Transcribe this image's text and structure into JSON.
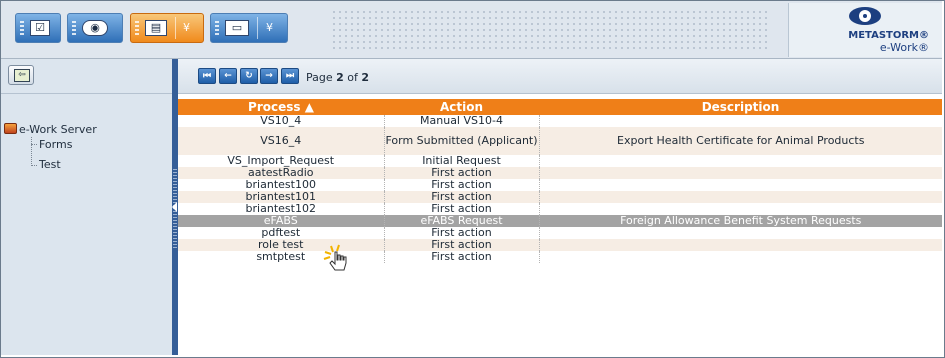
{
  "toolbar": {
    "buttons": [
      {
        "name": "todo-list",
        "icon": "checkbox-icon",
        "glyph": "☑"
      },
      {
        "name": "watch-list",
        "icon": "eye-icon",
        "glyph": "◉"
      },
      {
        "name": "procedures",
        "icon": "documents-icon",
        "glyph": "▤"
      },
      {
        "name": "folders",
        "icon": "briefcase-icon",
        "glyph": "▭"
      }
    ],
    "dropdown_glyph": "¥"
  },
  "logo": {
    "name": "METASTORM®",
    "sub": "e-Work®"
  },
  "left_pane": {
    "back_glyph": "⇦",
    "tree": {
      "root": "e-Work Server",
      "children": [
        "Forms",
        "Test"
      ]
    }
  },
  "pager": {
    "first": "⏮",
    "prev": "←",
    "refresh": "↻",
    "next": "→",
    "last": "⏭",
    "text_prefix": "Page ",
    "current": "2",
    "text_mid": " of ",
    "total": "2"
  },
  "table": {
    "headers": {
      "process": "Process ▲",
      "action": "Action",
      "description": "Description"
    },
    "rows": [
      {
        "process": "VS10_4",
        "action": "Manual VS10-4",
        "description": ""
      },
      {
        "process": "VS16_4",
        "action": "Form Submitted (Applicant)",
        "description": "Export Health Certificate for Animal Products"
      },
      {
        "process": "VS_Import_Request",
        "action": "Initial Request",
        "description": ""
      },
      {
        "process": "aatestRadio",
        "action": "First action",
        "description": ""
      },
      {
        "process": "briantest100",
        "action": "First action",
        "description": ""
      },
      {
        "process": "briantest101",
        "action": "First action",
        "description": ""
      },
      {
        "process": "briantest102",
        "action": "First action",
        "description": ""
      },
      {
        "process": "eFABS",
        "action": "eFABS Request",
        "description": "Foreign Allowance Benefit System Requests"
      },
      {
        "process": "pdftest",
        "action": "First action",
        "description": ""
      },
      {
        "process": "role test",
        "action": "First action",
        "description": ""
      },
      {
        "process": "smtptest",
        "action": "First action",
        "description": ""
      }
    ],
    "selected_index": 7
  },
  "colors": {
    "accent": "#ef7f18",
    "selected_row": "#a3a3a3",
    "splitter": "#355e98"
  }
}
